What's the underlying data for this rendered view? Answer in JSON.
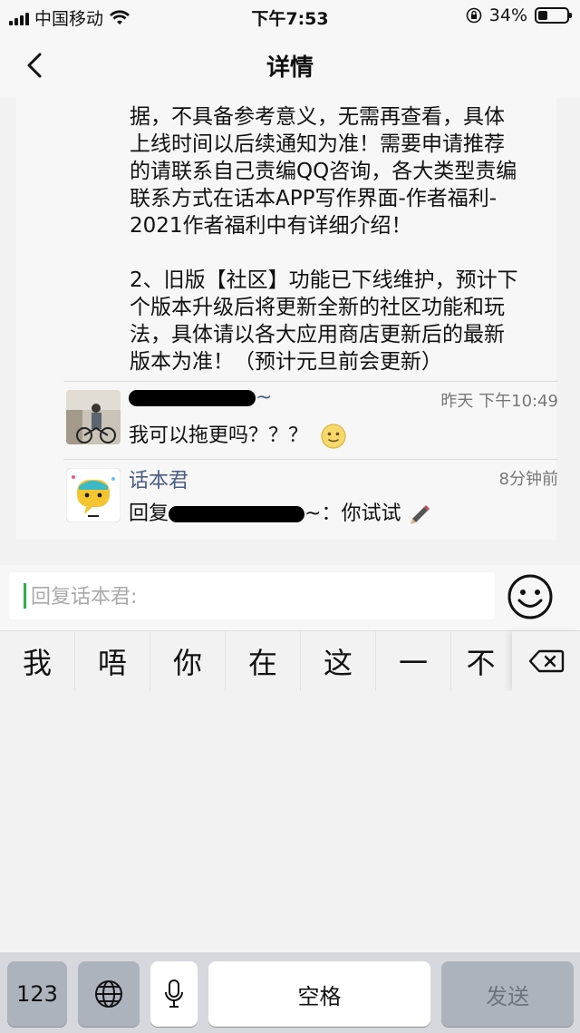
{
  "status_bar": {
    "carrier": "中国移动",
    "time": "下午7:53",
    "battery": "34%",
    "battery_level": 0.34
  },
  "nav": {
    "title": "详情",
    "back_icon": "chevron-left-icon"
  },
  "post": {
    "text": "据，不具备参考意义，无需再查看，具体\n上线时间以后续通知为准！需要申请推荐\n的请联系自己责编QQ咨询，各大类型责编\n联系方式在话本APP写作界面-作者福利-\n2021作者福利中有详细介绍！\n\n2、旧版【社区】功能已下线维护，预计下\n个版本升级后将更新全新的社区功能和玩\n法，具体请以各大应用商店更新后的最新\n版本为准！（预计元旦前会更新）"
  },
  "comments": [
    {
      "name_suffix": "~",
      "time": "昨天 下午10:49",
      "message": "我可以拖更吗？？？",
      "emoji_icon": "smile-emoji-icon"
    },
    {
      "name": "话本君",
      "time": "8分钟前",
      "reply_prefix": "回复",
      "reply_suffix": "~：你试试",
      "emoji_icon": "pencil-emoji-icon"
    }
  ],
  "reply": {
    "placeholder": "回复话本君:",
    "emoji_button_icon": "smiley-face-icon"
  },
  "ime": {
    "candidates": [
      "我",
      "唔",
      "你",
      "在",
      "这",
      "一",
      "不"
    ],
    "delete_icon": "backspace-icon",
    "keys": {
      "numbers": "123",
      "globe_icon": "globe-icon",
      "mic_icon": "microphone-icon",
      "space": "空格",
      "send": "发送"
    }
  }
}
